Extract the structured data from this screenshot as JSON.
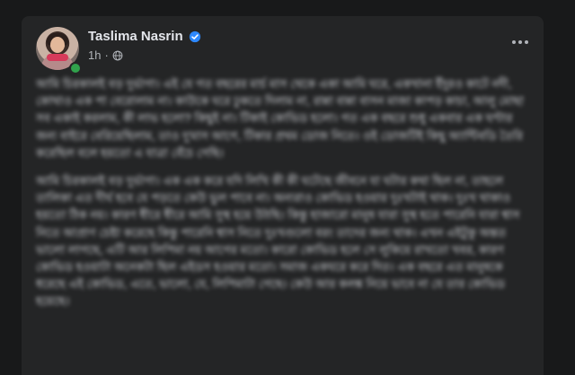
{
  "post": {
    "author": "Taslima Nasrin",
    "time": "1h",
    "separator": "·",
    "verified_icon": "verified-badge-icon",
    "privacy_icon": "globe-icon",
    "more_icon": "more-options-icon",
    "paragraphs": [
      "আমি চিরকালই বড় দুর্ভাগা। এই যে গত বছরের মার্চ মাস থেকে একা আমি ঘরে, একখানা ইঁদুরও কাটে নদী, কোথাও এক পা বেরোলাম না। কাউকে ঘরে ঢুকতে দিলাম না, রান্না বান্না বাসন মাজা কাপড় কাচা, আলু মোছা সব একাই করলাম, কী লাভ হলো? কিছুই না। টিকাই কোভিড হলো। গত এক বছরে শুধু একবার এক ঘণ্টার জন্য বাইরে বেরিয়েছিলাম, তাও দু'মাস আগে, টিকার প্রথম ডোজ নিতে। ওই ডোজটিই কিছু অ্যান্টিবডি তৈরি করেছিল বলে হয়তো এ যাত্রা বেঁচে গেছি।",
      "আমি চিরকালই বড় দুর্ভাগা। এক এক করে যদি লিখি কী কী ঘটেছে জীবনে যা ঘটার কথা ছিল না, তাহলে তালিকা এত দীর্ঘ হবে যে পড়তে কেউ ভুল পাবে না। অন্যরাও কোভিড হওয়ার দুঃখটাই থাক। দুঃখ থাকাও হয়তো ঠিক নয়। কারণ ধীরে ধীরে আমি সুস্থ হয়ে উঠছি। কিন্তু হাজারো মানুষ যারা সুস্থ হতে পারেনি যারা শ্বাস নিতে আপ্রাণ চেষ্টা করেছে কিন্তু পারেনি শ্বাস নিতে দুঃখগুলো বরং তাদের জন্য থাক। এখন এইটুকু অন্তত ভালো লাগছে, এটি আর লিপিমা নয় আগের মতো। কারো কোভিড হলে সে লুকিয়ে রাখতো খবর, কারণ কোভিড হওয়াটা অনেকটা ছিল এইডস হওয়ার মতো। সমাজ একঘরে করে দিত। এক বছরে এত মানুষকে ধরেছে এই কোভিড, এতে, ভালো, যে, লিপিমাটা গেছে। কেউ আর কলঙ্ক নিয়ে ভাবে না যে তার কোভিড হয়েছে।"
    ]
  }
}
